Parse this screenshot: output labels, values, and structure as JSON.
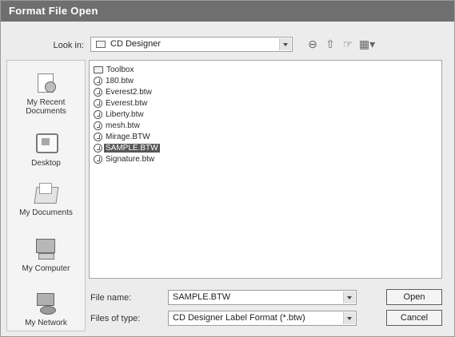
{
  "window": {
    "title": "Format File Open"
  },
  "lookin": {
    "label": "Look in:",
    "value": "CD Designer"
  },
  "toolbar": {
    "back_glyph": "⊖",
    "up_glyph": "⇧",
    "newfolder_glyph": "☞",
    "views_glyph": "▦▾"
  },
  "places": [
    {
      "label": "My Recent Documents"
    },
    {
      "label": "Desktop"
    },
    {
      "label": "My Documents"
    },
    {
      "label": "My Computer"
    },
    {
      "label": "My Network"
    }
  ],
  "files": [
    {
      "name": "Toolbox",
      "type": "folder"
    },
    {
      "name": "180.btw",
      "type": "file"
    },
    {
      "name": "Everest2.btw",
      "type": "file"
    },
    {
      "name": "Everest.btw",
      "type": "file"
    },
    {
      "name": "Liberty.btw",
      "type": "file"
    },
    {
      "name": "mesh.btw",
      "type": "file"
    },
    {
      "name": "Mirage.BTW",
      "type": "file"
    },
    {
      "name": "SAMPLE.BTW",
      "type": "file",
      "selected": true
    },
    {
      "name": "Signature.btw",
      "type": "file"
    }
  ],
  "filename": {
    "label": "File name:",
    "value": "SAMPLE.BTW"
  },
  "filetype": {
    "label": "Files of type:",
    "value": "CD Designer Label Format (*.btw)"
  },
  "buttons": {
    "open": "Open",
    "cancel": "Cancel"
  }
}
